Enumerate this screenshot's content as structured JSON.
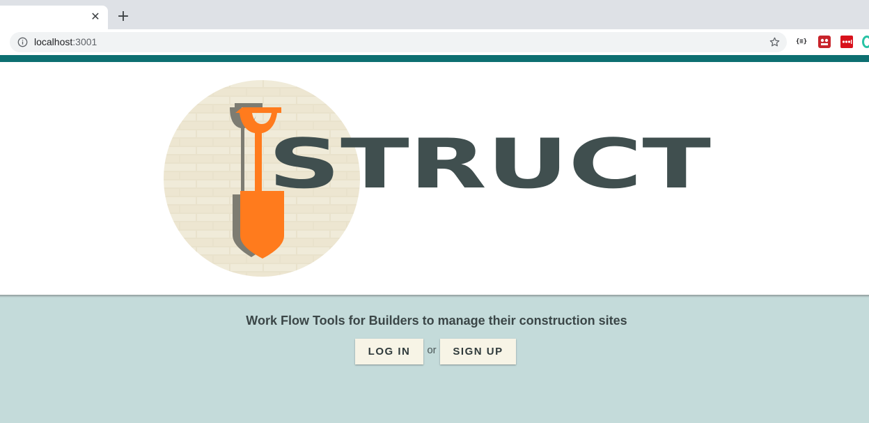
{
  "browser": {
    "url_host": "localhost",
    "url_port": ":3001",
    "tab_close_glyph": "✕",
    "new_tab_glyph": "+",
    "extensions": [
      {
        "icon": "json-formatter-icon",
        "label": "{≡}"
      },
      {
        "icon": "red-extension-icon"
      },
      {
        "icon": "lastpass-icon"
      },
      {
        "icon": "green-ring-extension-icon"
      }
    ]
  },
  "colors": {
    "accent_bar": "#0d6f71",
    "page_bg": "#c4dbda",
    "brand_text": "#404f4f",
    "shovel": "#ff7b1d",
    "button_bg": "#f7f4e6"
  },
  "logo": {
    "wordmark": "STRUCT"
  },
  "main": {
    "tagline": "Work Flow Tools for Builders to manage their construction sites",
    "login_label": "LOG IN",
    "or_label": "or",
    "signup_label": "SIGN UP"
  }
}
